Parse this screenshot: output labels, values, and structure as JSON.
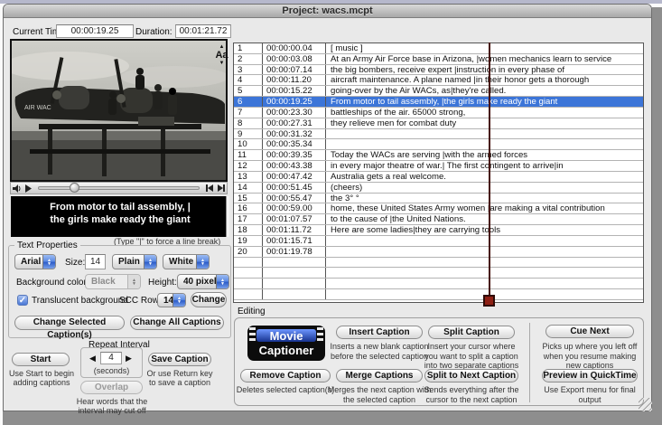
{
  "window": {
    "title": "Project: wacs.mcpt"
  },
  "toolbar": {
    "current_time_label": "Current Time:",
    "current_time_value": "00:00:19.25",
    "duration_label": "Duration:",
    "duration_value": "00:01:21.72"
  },
  "video": {
    "nose_art_text": "AIR WAC",
    "caption_line1": "From motor to tail assembly, |",
    "caption_line2": "the girls make ready the giant"
  },
  "table_font_control": {
    "label": "Aa"
  },
  "line_break_hint": "(Type  \"|\" to force a line break)",
  "captions": {
    "selected_index": 5,
    "empty_filler_rows": 4,
    "rows": [
      {
        "n": "1",
        "time": "00:00:00.04",
        "text": "[ music ]"
      },
      {
        "n": "2",
        "time": "00:00:03.08",
        "text": "At an Army Air Force base in Arizona, |women mechanics learn to service"
      },
      {
        "n": "3",
        "time": "00:00:07.14",
        "text": "the big bombers, receive expert |instruction in every phase of"
      },
      {
        "n": "4",
        "time": "00:00:11.20",
        "text": "aircraft maintenance. A plane named |in their honor gets a thorough"
      },
      {
        "n": "5",
        "time": "00:00:15.22",
        "text": "going-over by the Air WACs, as|they're called."
      },
      {
        "n": "6",
        "time": "00:00:19.25",
        "text": "From motor to tail assembly, |the girls make ready the giant"
      },
      {
        "n": "7",
        "time": "00:00:23.30",
        "text": "battleships of the air. 65000 strong,"
      },
      {
        "n": "8",
        "time": "00:00:27.31",
        "text": "they relieve men for combat duty"
      },
      {
        "n": "9",
        "time": "00:00:31.32",
        "text": ""
      },
      {
        "n": "10",
        "time": "00:00:35.34",
        "text": ""
      },
      {
        "n": "11",
        "time": "00:00:39.35",
        "text": "Today the WACs are serving |with the armed forces"
      },
      {
        "n": "12",
        "time": "00:00:43.38",
        "text": "in every major theatre of war.| The first contingent to arrive|in"
      },
      {
        "n": "13",
        "time": "00:00:47.42",
        "text": "Australia gets a real welcome."
      },
      {
        "n": "14",
        "time": "00:00:51.45",
        "text": "(cheers)"
      },
      {
        "n": "15",
        "time": "00:00:55.47",
        "text": "the 3° °"
      },
      {
        "n": "16",
        "time": "00:00:59.00",
        "text": "home, these United States Army women |are making a vital contribution"
      },
      {
        "n": "17",
        "time": "00:01:07.57",
        "text": "to the cause of |the United Nations."
      },
      {
        "n": "18",
        "time": "00:01:11.72",
        "text": "Here are some ladies|they are carrying tools"
      },
      {
        "n": "19",
        "time": "00:01:15.71",
        "text": ""
      },
      {
        "n": "20",
        "time": "00:01:19.78",
        "text": ""
      }
    ]
  },
  "text_properties": {
    "legend": "Text Properties",
    "font_family": "Arial",
    "size_label": "Size:",
    "size_value": "14",
    "style_value": "Plain",
    "color_value": "White",
    "background_color_label": "Background color",
    "background_color_value": "Black",
    "height_label": "Height:",
    "height_value": "40 pixels",
    "translucent_label": "Translucent background",
    "scc_row_label": "SCC Row:",
    "scc_row_value": "14",
    "change_button": "Change",
    "change_selected_button": "Change Selected Caption(s)",
    "change_all_button": "Change All Captions"
  },
  "capture": {
    "repeat_interval_label": "Repeat Interval",
    "start_button": "Start",
    "start_hint_line1": "Use Start to begin",
    "start_hint_line2": "adding captions",
    "interval_value": "4",
    "interval_unit": "(seconds)",
    "overlap_button": "Overlap",
    "overlap_hint_line1": "Hear words that the",
    "overlap_hint_line2": "interval may cut off",
    "save_button": "Save Caption",
    "save_hint_line1": "Or use Return key",
    "save_hint_line2": "to save a caption"
  },
  "editing": {
    "label": "Editing",
    "logo_line1": "Movie",
    "logo_line2": "Captioner",
    "insert_button": "Insert Caption",
    "insert_desc": "Inserts a new blank caption before the selected caption",
    "split_button": "Split Caption",
    "split_desc": "Insert your cursor where you want to split a caption into two separate captions",
    "cue_button": "Cue Next",
    "cue_desc": "Picks up where you left off when you resume making new captions",
    "remove_button": "Remove Caption",
    "remove_desc": "Deletes selected caption(s)",
    "merge_button": "Merge Captions",
    "merge_desc": "Merges the next caption with the selected caption",
    "split_next_button": "Split to Next Caption",
    "split_next_desc": "Sends everything after the cursor to the next caption",
    "preview_button": "Preview in QuickTime",
    "preview_desc": "Use Export menu for final output"
  },
  "icons": {
    "check": "✓",
    "arrow_up": "▲",
    "arrow_down": "▼",
    "arrow_left": "◀",
    "arrow_right": "▶"
  },
  "colors": {
    "selection": "#3c75d8",
    "marker": "#8e2015",
    "caption_bg": "#000000",
    "caption_text": "#ffffff"
  }
}
